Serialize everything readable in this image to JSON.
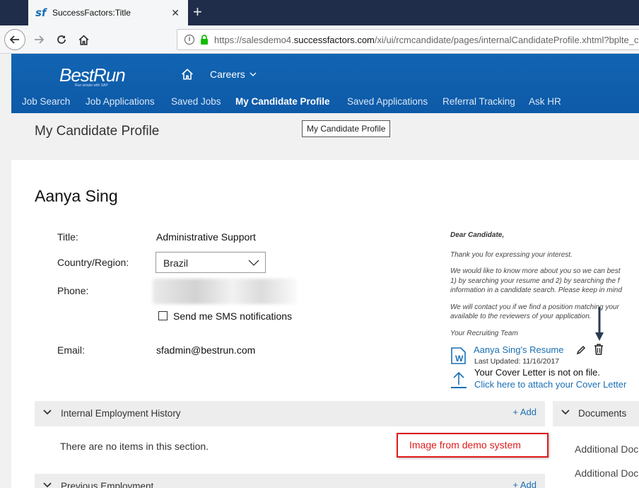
{
  "browser": {
    "tab_title": "SuccessFactors:Title",
    "tab_logo": "sf",
    "url_prefix": "https://salesdemo4.",
    "url_domain": "successfactors.com",
    "url_path": "/xi/ui/rcmcandidate/pages/internalCandidateProfile.xhtml?bplte_c"
  },
  "header": {
    "logo": "BestRun",
    "logo_tagline": "Run simple with SAP",
    "careers_label": "Careers",
    "nav": [
      "Job Search",
      "Job Applications",
      "Saved Jobs",
      "My Candidate Profile",
      "Saved Applications",
      "Referral Tracking",
      "Ask HR"
    ]
  },
  "page": {
    "title": "My Candidate Profile",
    "tooltip": "My Candidate Profile"
  },
  "profile": {
    "name": "Aanya Sing",
    "title_label": "Title:",
    "title_value": "Administrative Support",
    "country_label": "Country/Region:",
    "country_value": "Brazil",
    "phone_label": "Phone:",
    "sms_label": "Send me SMS notifications",
    "email_label": "Email:",
    "email_value": "sfadmin@bestrun.com"
  },
  "letter": {
    "greeting": "Dear Candidate,",
    "p1": "Thank you for expressing your interest.",
    "p2_l1": "We would like to know more about you so we can best",
    "p2_l2": "1) by searching your resume and 2) by searching the f",
    "p2_l3": "information in a candidate search. Please keep in mind",
    "p3_l1": "We will contact you if we find a position matching your",
    "p3_l2": "available to the reviewers of your application.",
    "sign": "Your Recruiting Team"
  },
  "attachments": {
    "resume_link": "Aanya Sing's Resume",
    "resume_updated": "Last Updated: 11/16/2017",
    "cover_status": "Your Cover Letter is not on file.",
    "cover_link": "Click here to attach your Cover Letter"
  },
  "sections": {
    "internal_title": "Internal Employment History",
    "internal_add": "+ Add",
    "empty_message": "There are no items in this section.",
    "previous_title": "Previous Employment",
    "previous_add": "+ Add",
    "documents_title": "Documents",
    "additional_1": "Additional Docu",
    "additional_2": "Additional Docu"
  },
  "annotation": {
    "demo_label": "Image from demo system"
  }
}
